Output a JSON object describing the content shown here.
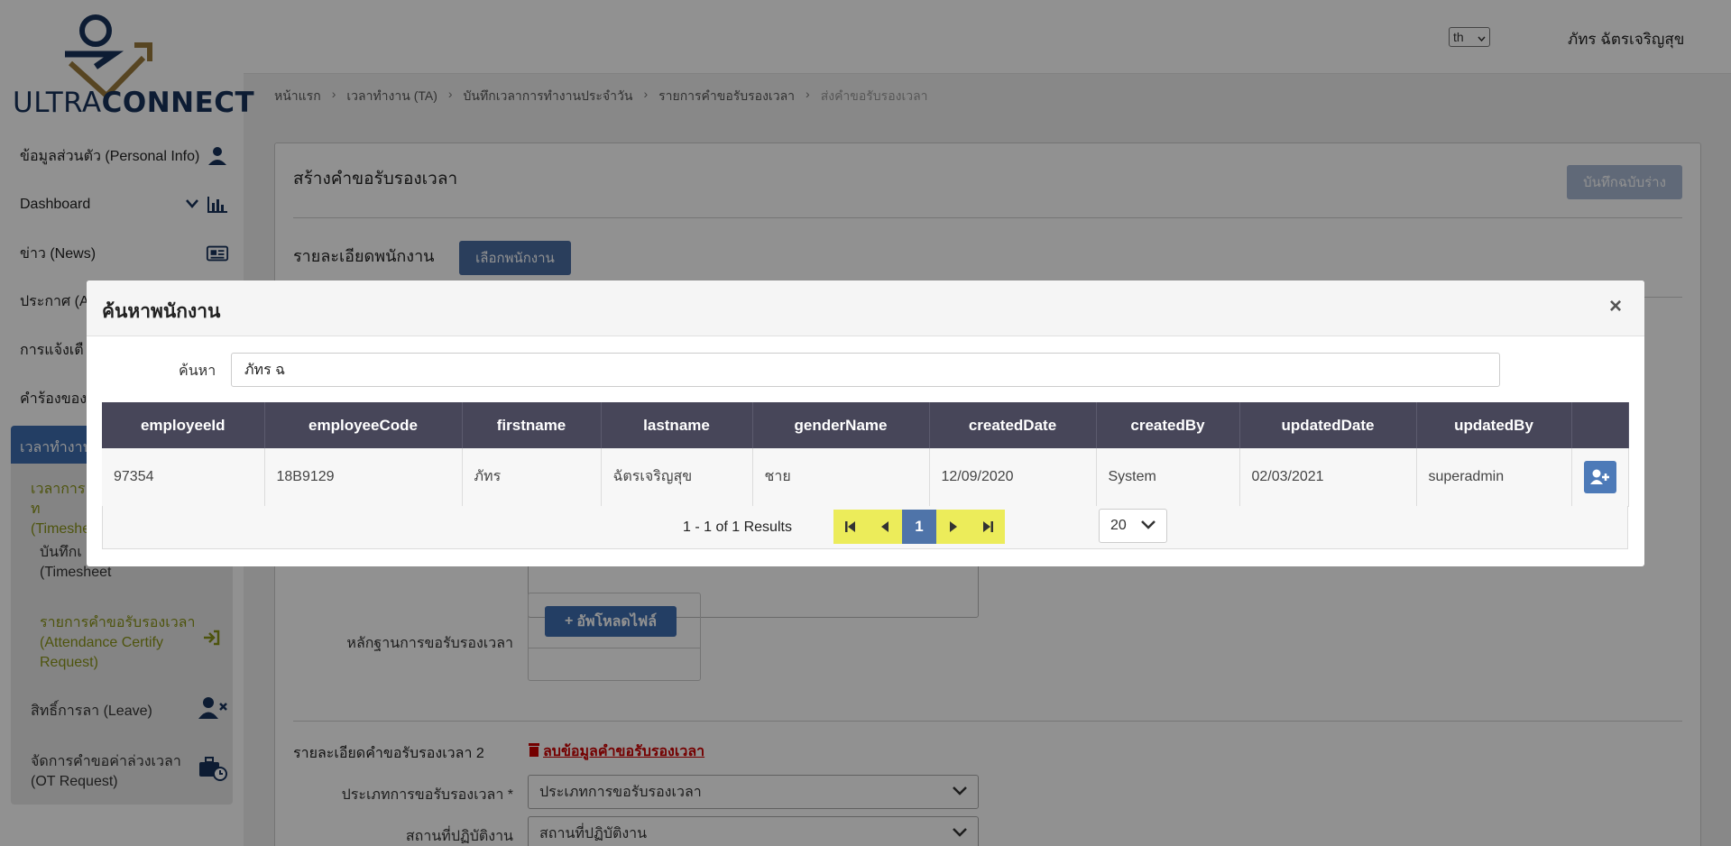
{
  "brand": {
    "logo_text_light": "ULTRA",
    "logo_text_bold": "CONNECT"
  },
  "header": {
    "language": "th",
    "user_name": "ภัทร ฉัตรเจริญสุข"
  },
  "sidebar": {
    "items": [
      {
        "label": "ข้อมูลส่วนตัว (Personal Info)",
        "icon": "user-icon"
      },
      {
        "label": "Dashboard",
        "icon": "bar-chart-icon"
      },
      {
        "label": "ข่าว (News)",
        "icon": "newspaper-icon"
      },
      {
        "label": "ประกาศ (A",
        "icon": ""
      },
      {
        "label": "การแจ้งเตื",
        "icon": ""
      },
      {
        "label": "คำร้องของ",
        "icon": ""
      }
    ],
    "group": {
      "label": "เวลาทำงาน",
      "sub_items": [
        {
          "label": "เวลาการท (Timeshe"
        },
        {
          "label": "บันทึกเ ประจำวัน (Timesheet"
        },
        {
          "label": "รายการคำขอรับรองเวลา (Attendance Certify Request)"
        }
      ]
    },
    "leave": {
      "label": "สิทธิ์การลา (Leave)"
    },
    "ot": {
      "label": "จัดการคำขอค่าล่วงเวลา (OT Request)"
    }
  },
  "breadcrumb": [
    "หน้าแรก",
    "เวลาทำงาน (TA)",
    "บันทึกเวลาการทำงานประจำวัน",
    "รายการคำขอรับรองเวลา",
    "ส่งคำขอรับรองเวลา"
  ],
  "page": {
    "title": "สร้างคำขอรับรองเวลา",
    "save_draft_label": "บันทึกฉบับร่าง",
    "employee_section_title": "รายละเอียดพนักงาน",
    "select_employee_label": "เลือกพนักงาน",
    "evidence_label": "หลักฐานการขอรับรองเวลา",
    "upload_label": "อัพโหลดไฟล์",
    "detail_section_title": "รายละเอียดคำขอรับรองเวลา 2",
    "delete_label": "ลบข้อมูลคำขอรับรองเวลา",
    "type_label": "ประเภทการขอรับรองเวลา *",
    "type_value": "ประเภทการขอรับรองเวลา",
    "location_label": "สถานที่ปฏิบัติงาน",
    "location_value": "สถานที่ปฏิบัติงาน"
  },
  "modal": {
    "title": "ค้นหาพนักงาน",
    "search_label": "ค้นหา",
    "search_value": "ภัทร ฉ",
    "columns": [
      "employeeId",
      "employeeCode",
      "firstname",
      "lastname",
      "genderName",
      "createdDate",
      "createdBy",
      "updatedDate",
      "updatedBy"
    ],
    "rows": [
      {
        "employeeId": "97354",
        "employeeCode": "18B9129",
        "firstname": "ภัทร",
        "lastname": "ฉัตรเจริญสุข",
        "genderName": "ชาย",
        "createdDate": "12/09/2020",
        "createdBy": "System",
        "updatedDate": "02/03/2021",
        "updatedBy": "superadmin"
      }
    ],
    "results_text": "1 - 1 of 1 Results",
    "current_page": "1",
    "page_size": "20"
  },
  "colors": {
    "header_dark": "#474659",
    "primary": "#3e6db0",
    "pager_yellow": "#ecec5a",
    "danger": "#cc0000"
  }
}
